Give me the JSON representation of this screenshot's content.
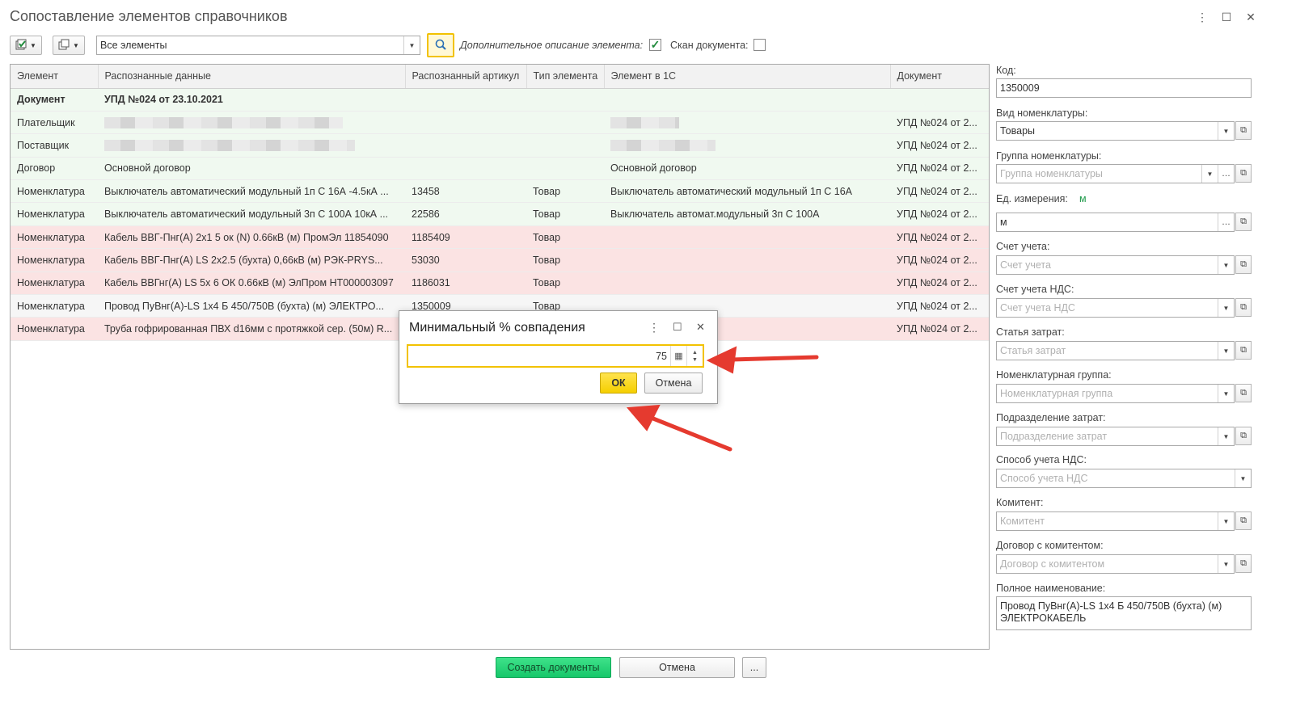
{
  "window": {
    "title": "Сопоставление элементов справочников",
    "menu_icon": "kebab-icon",
    "maximize_icon": "maximize-icon",
    "close_icon": "close-icon"
  },
  "toolbar": {
    "filter_value": "Все элементы",
    "extra_desc_label": "Дополнительное описание элемента:",
    "extra_desc_checked": true,
    "scan_label": "Скан документа:",
    "scan_checked": false
  },
  "table": {
    "columns": [
      "Элемент",
      "Распознанные данные",
      "Распознанный артикул",
      "Тип элемента",
      "Элемент в 1С",
      "Документ"
    ],
    "rows": [
      {
        "style": "bold",
        "cells": [
          "Документ",
          "УПД №024 от 23.10.2021",
          "",
          "",
          "",
          ""
        ]
      },
      {
        "style": "green",
        "cells": [
          "Плательщик",
          "",
          "",
          "",
          "",
          "УПД №024 от 2..."
        ]
      },
      {
        "style": "green",
        "cells": [
          "Поставщик",
          "",
          "",
          "",
          "",
          "УПД №024 от 2..."
        ]
      },
      {
        "style": "green",
        "cells": [
          "Договор",
          "Основной договор",
          "",
          "",
          "Основной договор",
          "УПД №024 от 2..."
        ]
      },
      {
        "style": "green",
        "cells": [
          "Номенклатура",
          "Выключатель автоматический модульный 1п С 16А -4.5кА ...",
          "13458",
          "Товар",
          "Выключатель автоматический модульный 1п С 16А",
          "УПД №024 от 2..."
        ]
      },
      {
        "style": "green",
        "cells": [
          "Номенклатура",
          "Выключатель автоматический модульный 3п С 100А 10кА ...",
          "22586",
          "Товар",
          "Выключатель автомат.модульный 3п С 100А",
          "УПД №024 от 2..."
        ]
      },
      {
        "style": "red",
        "cells": [
          "Номенклатура",
          "Кабель ВВГ-Пнг(А) 2х1 5 ок (N) 0.66кВ (м) ПромЭл 11854090",
          "1185409",
          "Товар",
          "",
          "УПД №024 от 2..."
        ]
      },
      {
        "style": "red",
        "cells": [
          "Номенклатура",
          "Кабель ВВГ-Пнг(А) LS 2х2.5 (бухта) 0,66кВ (м) РЭК-PRYS...",
          "53030",
          "Товар",
          "",
          "УПД №024 от 2..."
        ]
      },
      {
        "style": "red",
        "cells": [
          "Номенклатура",
          "Кабель ВВГнг(А) LS 5х 6 ОК 0.66кВ (м) ЭлПром НТ000003097",
          "1186031",
          "Товар",
          "",
          "УПД №024 от 2..."
        ]
      },
      {
        "style": "plain",
        "cells": [
          "Номенклатура",
          "Провод ПуВнг(А)-LS 1х4 Б 450/750В (бухта) (м) ЭЛЕКТРО...",
          "1350009",
          "Товар",
          "",
          "УПД №024 от 2..."
        ]
      },
      {
        "style": "red",
        "cells": [
          "Номенклатура",
          "Труба гофрированная ПВХ d16мм с протяжкой сер. (50м) R...",
          "",
          "",
          "",
          "УПД №024 от 2..."
        ]
      }
    ]
  },
  "panel": {
    "code_label": "Код:",
    "code_value": "1350009",
    "nom_type_label": "Вид номенклатуры:",
    "nom_type_value": "Товары",
    "group_label": "Группа номенклатуры:",
    "group_placeholder": "Группа номенклатуры",
    "unit_label": "Ед. измерения:",
    "unit_hint": "м",
    "unit_value": "м",
    "account_label": "Счет учета:",
    "account_placeholder": "Счет учета",
    "vat_account_label": "Счет учета НДС:",
    "vat_account_placeholder": "Счет учета НДС",
    "cost_item_label": "Статья затрат:",
    "cost_item_placeholder": "Статья затрат",
    "nom_group_label": "Номенклатурная группа:",
    "nom_group_placeholder": "Номенклатурная группа",
    "division_label": "Подразделение затрат:",
    "division_placeholder": "Подразделение затрат",
    "vat_method_label": "Способ учета НДС:",
    "vat_method_placeholder": "Способ учета НДС",
    "committent_label": "Комитент:",
    "committent_placeholder": "Комитент",
    "contract_label": "Договор с комитентом:",
    "contract_placeholder": "Договор с комитентом",
    "fullname_label": "Полное наименование:",
    "fullname_value": "Провод ПуВнг(А)-LS 1х4 Б 450/750В (бухта) (м) ЭЛЕКТРОКАБЕЛЬ"
  },
  "footer": {
    "create_label": "Создать документы",
    "cancel_label": "Отмена",
    "more_label": "..."
  },
  "dialog": {
    "title": "Минимальный % совпадения",
    "value": "75",
    "ok_label": "ОК",
    "cancel_label": "Отмена"
  },
  "colors": {
    "accent_yellow": "#f2c200",
    "green_button": "#16c76a",
    "row_green": "#f0f9f0",
    "row_red": "#fbe3e3",
    "annotation_arrow": "#e53a2f"
  }
}
